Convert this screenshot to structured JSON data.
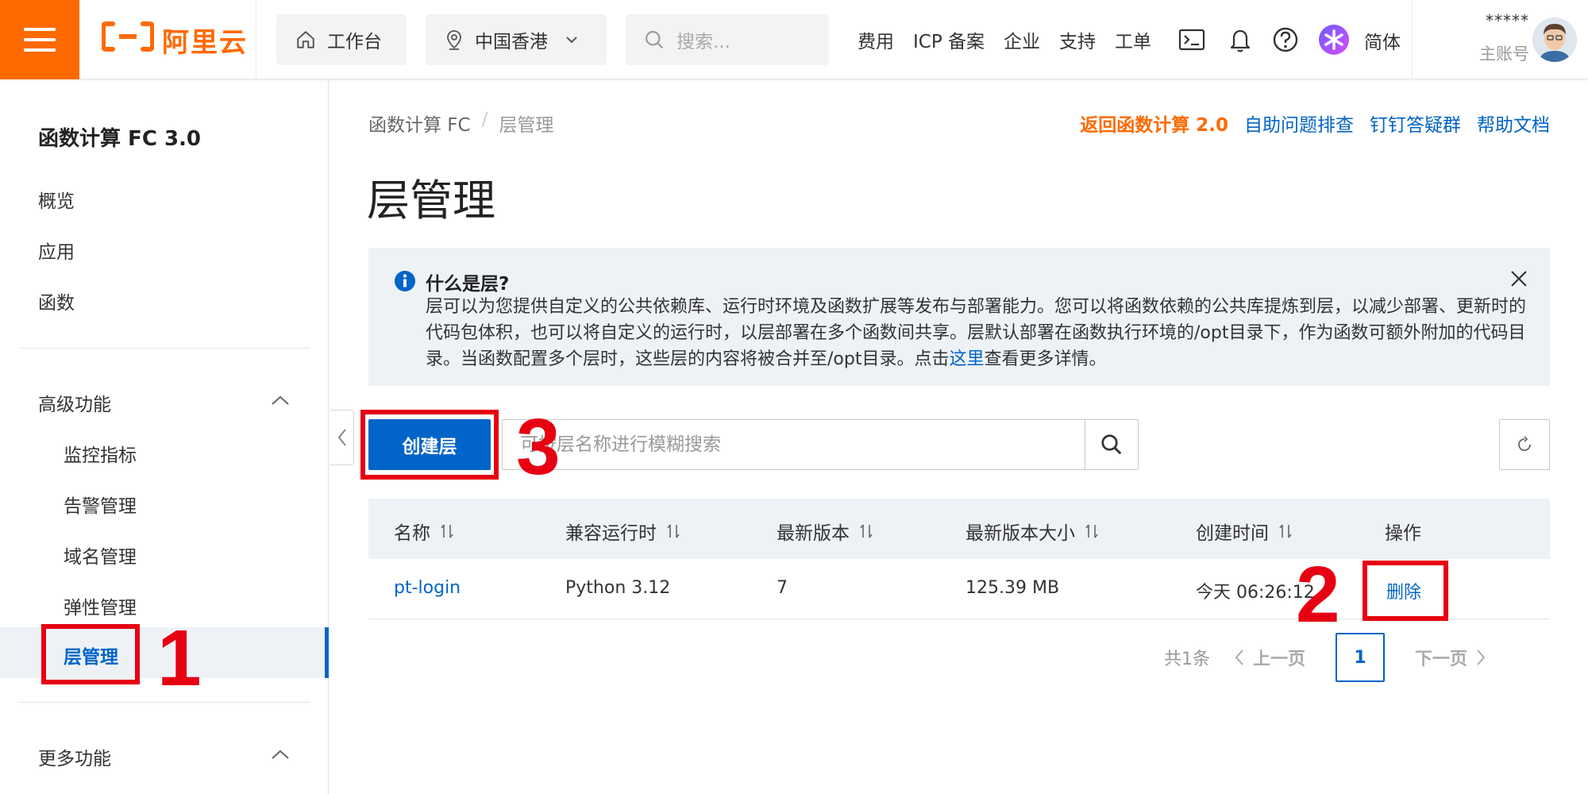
{
  "topbar": {
    "logo_text": "阿里云",
    "workbench": "工作台",
    "region": "中国香港",
    "search_placeholder": "搜索...",
    "links": [
      "费用",
      "ICP 备案",
      "企业",
      "支持",
      "工单"
    ],
    "language": "简体",
    "account_name": "*****",
    "account_role": "主账号",
    "brand_color": "#ff6a00"
  },
  "sidebar": {
    "title": "函数计算 FC 3.0",
    "items": [
      "概览",
      "应用",
      "函数"
    ],
    "advanced_group": "高级功能",
    "advanced_items": [
      "监控指标",
      "告警管理",
      "域名管理",
      "弹性管理"
    ],
    "active_item": "层管理",
    "more_group": "更多功能"
  },
  "breadcrumb": {
    "root": "函数计算 FC",
    "separator": "/",
    "current": "层管理"
  },
  "header_links": {
    "back_v2": "返回函数计算 2.0",
    "self_help": "自助问题排查",
    "dingtalk": "钉钉答疑群",
    "docs": "帮助文档"
  },
  "page": {
    "title": "层管理"
  },
  "notice": {
    "title": "什么是层?",
    "body_before_link": "层可以为您提供自定义的公共依赖库、运行时环境及函数扩展等发布与部署能力。您可以将函数依赖的公共库提炼到层，以减少部署、更新时的代码包体积，也可以将自定义的运行时，以层部署在多个函数间共享。层默认部署在函数执行环境的/opt目录下，作为函数可额外附加的代码目录。当函数配置多个层时，这些层的内容将被合并至/opt目录。点击",
    "link_text": "这里",
    "body_after_link": "查看更多详情。"
  },
  "toolbar": {
    "create_label": "创建层",
    "search_placeholder": "可按层名称进行模糊搜索"
  },
  "table": {
    "columns": [
      "名称",
      "兼容运行时",
      "最新版本",
      "最新版本大小",
      "创建时间",
      "操作"
    ],
    "rows": [
      {
        "name": "pt-login",
        "runtime": "Python 3.12",
        "version": "7",
        "size": "125.39 MB",
        "created": "今天 06:26:12",
        "action": "删除"
      }
    ]
  },
  "pagination": {
    "total": "共1条",
    "prev": "上一页",
    "current": "1",
    "next": "下一页"
  },
  "annotations": {
    "marker_1": "1",
    "marker_2": "2",
    "marker_3": "3",
    "color": "#e60012"
  }
}
